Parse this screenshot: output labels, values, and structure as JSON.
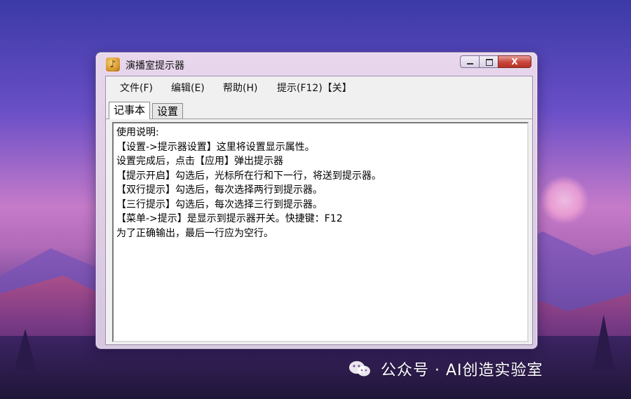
{
  "window": {
    "title": "演播室提示器",
    "controls": {
      "minimize": "—",
      "maximize": "□",
      "close": "X"
    }
  },
  "menu": {
    "items": [
      "文件(F)",
      "编辑(E)",
      "帮助(H)",
      "提示(F12)【关】"
    ]
  },
  "tabs": [
    {
      "label": "记事本",
      "active": true
    },
    {
      "label": "设置",
      "active": false
    }
  ],
  "editor": {
    "lines": [
      "使用说明:",
      "【设置->提示器设置】这里将设置显示属性。",
      "设置完成后，点击【应用】弹出提示器",
      "【提示开启】勾选后，光标所在行和下一行，将送到提示器。",
      "【双行提示】勾选后，每次选择两行到提示器。",
      "【三行提示】勾选后，每次选择三行到提示器。",
      "【菜单->提示】是显示到提示器开关。快捷键：F12",
      "为了正确输出，最后一行应为空行。"
    ]
  },
  "watermark": {
    "text": "公众号 · AI创造实验室"
  },
  "colors": {
    "close_button": "#c7453a",
    "window_frame": "#e8d6ec"
  }
}
